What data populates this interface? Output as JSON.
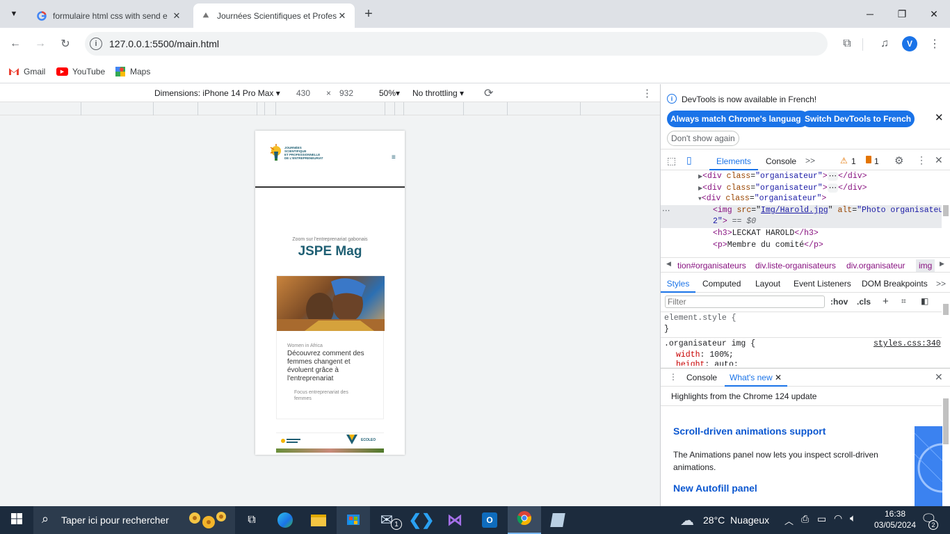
{
  "browser": {
    "tabs": [
      {
        "title": "formulaire html css with send e",
        "favicon": "google-favicon"
      },
      {
        "title": "Journées Scientifiques et Profes",
        "favicon": "site-favicon"
      }
    ],
    "new_tab": "+",
    "address": "127.0.0.1:5500/main.html",
    "profile_initial": "V",
    "bookmarks": [
      "Gmail",
      "YouTube",
      "Maps"
    ]
  },
  "device_toolbar": {
    "dimensions": "Dimensions: iPhone 14 Pro Max",
    "width": "430",
    "times": "×",
    "height": "932",
    "zoom": "50%",
    "throttling": "No throttling"
  },
  "site": {
    "logo_text": "JOURNÉES SCIENTIFIQUE ET PROFESSIONNELLE DE L'ENTREPRENEURIAT",
    "logo_lines": [
      "JOURNÉES",
      "SCIENTIFIQUE",
      "ET PROFESSIONNELLE",
      "DE L'ENTREPRENEURIAT"
    ],
    "menu_icon": "≡",
    "kicker": "Zoom sur l'entreprenariat gabonais",
    "title": "JSPE Mag",
    "card": {
      "category": "Women in Africa",
      "headline": "Découvrez comment des femmes changent et évoluent grâce à l'entreprenariat",
      "tag": "Focus entreprenariat des femmes"
    },
    "sponsor_text": "ECOLEO"
  },
  "devtools": {
    "banner": {
      "message": "DevTools is now available in French!",
      "btn_match": "Always match Chrome's language",
      "btn_switch": "Switch DevTools to French",
      "btn_dont_show": "Don't show again"
    },
    "tabs": [
      "Elements",
      "Console",
      ">>"
    ],
    "warnings": "1",
    "errors": "1",
    "dom": {
      "line1_tag_open": "<div",
      "line1_attr": "class",
      "line1_val": "\"organisateur\"",
      "line1_close": "</div>",
      "line3_close": ">",
      "img_src_attr": "src",
      "img_src_val": "Img/Harold.jpg",
      "img_alt_attr": "alt",
      "img_alt_val": "\"Photo organisateur",
      "img_alt_val2": "2\"",
      "dollar": "== $0",
      "h3": "LECKAT HAROLD",
      "p": "Membre du comité"
    },
    "breadcrumbs": [
      "tion#organisateurs",
      "div.liste-organisateurs",
      "div.organisateur",
      "img"
    ],
    "style_tabs": [
      "Styles",
      "Computed",
      "Layout",
      "Event Listeners",
      "DOM Breakpoints",
      ">>"
    ],
    "filter_placeholder": "Filter",
    "hov": ":hov",
    "cls": ".cls",
    "element_style": "element.style {",
    "brace_close": "}",
    "rule_selector": ".organisateur img {",
    "rule_source": "styles.css:340",
    "prop1_name": "width",
    "prop1_val": "100%;",
    "prop2_name": "height",
    "prop2_val": "auto;",
    "drawer_tabs": [
      "Console",
      "What's new"
    ],
    "whats_new_header": "Highlights from the Chrome 124 update",
    "whats_new_title1": "Scroll-driven animations support",
    "whats_new_body1": "The Animations panel now lets you inspect scroll-driven animations.",
    "whats_new_title2": "New Autofill panel"
  },
  "taskbar": {
    "search_placeholder": "Taper ici pour rechercher",
    "weather": "28°C  Nuageux",
    "time": "16:38",
    "date": "03/05/2024",
    "notification_count": "2",
    "outlook_badge": "1"
  },
  "colors": {
    "accent": "#1a73e8",
    "brand_teal": "#1f5f73",
    "taskbar": "#1c2b3d",
    "tab_strip": "#dee1e6"
  }
}
